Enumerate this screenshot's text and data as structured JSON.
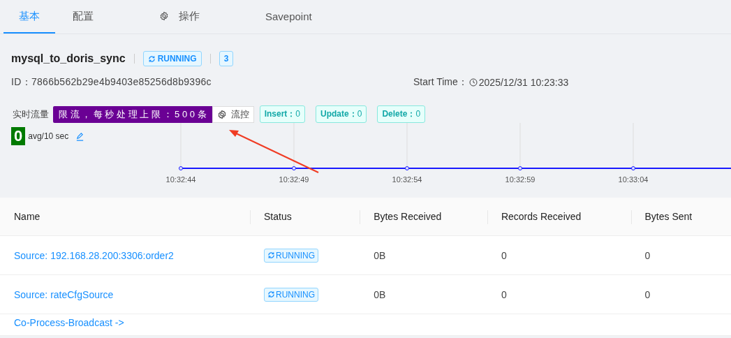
{
  "tabs": [
    {
      "label": "基本",
      "selected": true,
      "icon": false
    },
    {
      "label": "配置",
      "selected": false,
      "icon": false
    },
    {
      "label": "操作",
      "selected": false,
      "icon": true
    },
    {
      "label": "Savepoint",
      "selected": false,
      "icon": false
    }
  ],
  "job": {
    "name": "mysql_to_doris_sync",
    "status": "RUNNING",
    "count": "3",
    "id_label": "ID：",
    "id": "7866b562b29e4b9403e85256d8b9396c",
    "start_label": "Start Time：",
    "start_time": "2025/12/31 10:23:33"
  },
  "stream": {
    "label": "实时流量",
    "limit_text": "限 流 ， 每 秒 处 理 上 限 ： 5 0 0 条",
    "control_button": "流控",
    "counters": [
      {
        "label": "Insert：",
        "value": "0"
      },
      {
        "label": "Update：",
        "value": "0"
      },
      {
        "label": "Delete：",
        "value": "0"
      }
    ],
    "rate": "0",
    "rate_unit": "avg/10 sec",
    "x_labels": [
      "10:32:44",
      "10:32:49",
      "10:32:54",
      "10:32:59",
      "10:33:04"
    ]
  },
  "table": {
    "columns": [
      "Name",
      "Status",
      "Bytes Received",
      "Records Received",
      "Bytes Sent"
    ],
    "rows": [
      {
        "name": "Source: 192.168.28.200:3306:order2",
        "status": "RUNNING",
        "bytes_received": "0B",
        "records_received": "0",
        "bytes_sent": "0"
      },
      {
        "name": "Source: rateCfgSource",
        "status": "RUNNING",
        "bytes_received": "0B",
        "records_received": "0",
        "bytes_sent": "0"
      },
      {
        "name": "Co-Process-Broadcast ->"
      }
    ]
  }
}
